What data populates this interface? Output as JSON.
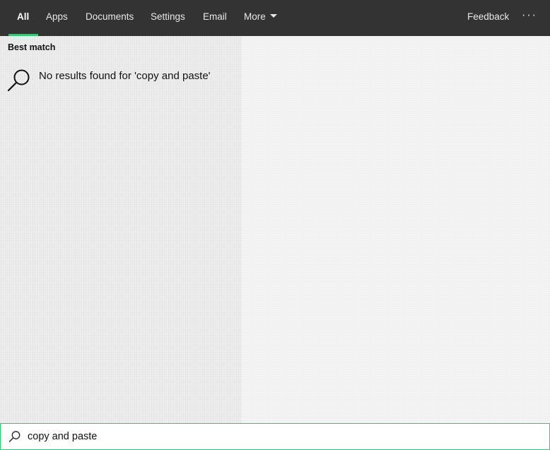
{
  "nav": {
    "tabs": [
      {
        "label": "All",
        "active": true
      },
      {
        "label": "Apps"
      },
      {
        "label": "Documents"
      },
      {
        "label": "Settings"
      },
      {
        "label": "Email"
      },
      {
        "label": "More"
      }
    ],
    "feedback_label": "Feedback",
    "more_options_label": "···"
  },
  "results": {
    "section_heading": "Best match",
    "empty_message": "No results found for 'copy and paste'",
    "icon": "search-icon"
  },
  "search": {
    "value": "copy and paste",
    "icon": "search-icon"
  },
  "colors": {
    "topbar": "#333333",
    "accent": "#3ec276"
  }
}
